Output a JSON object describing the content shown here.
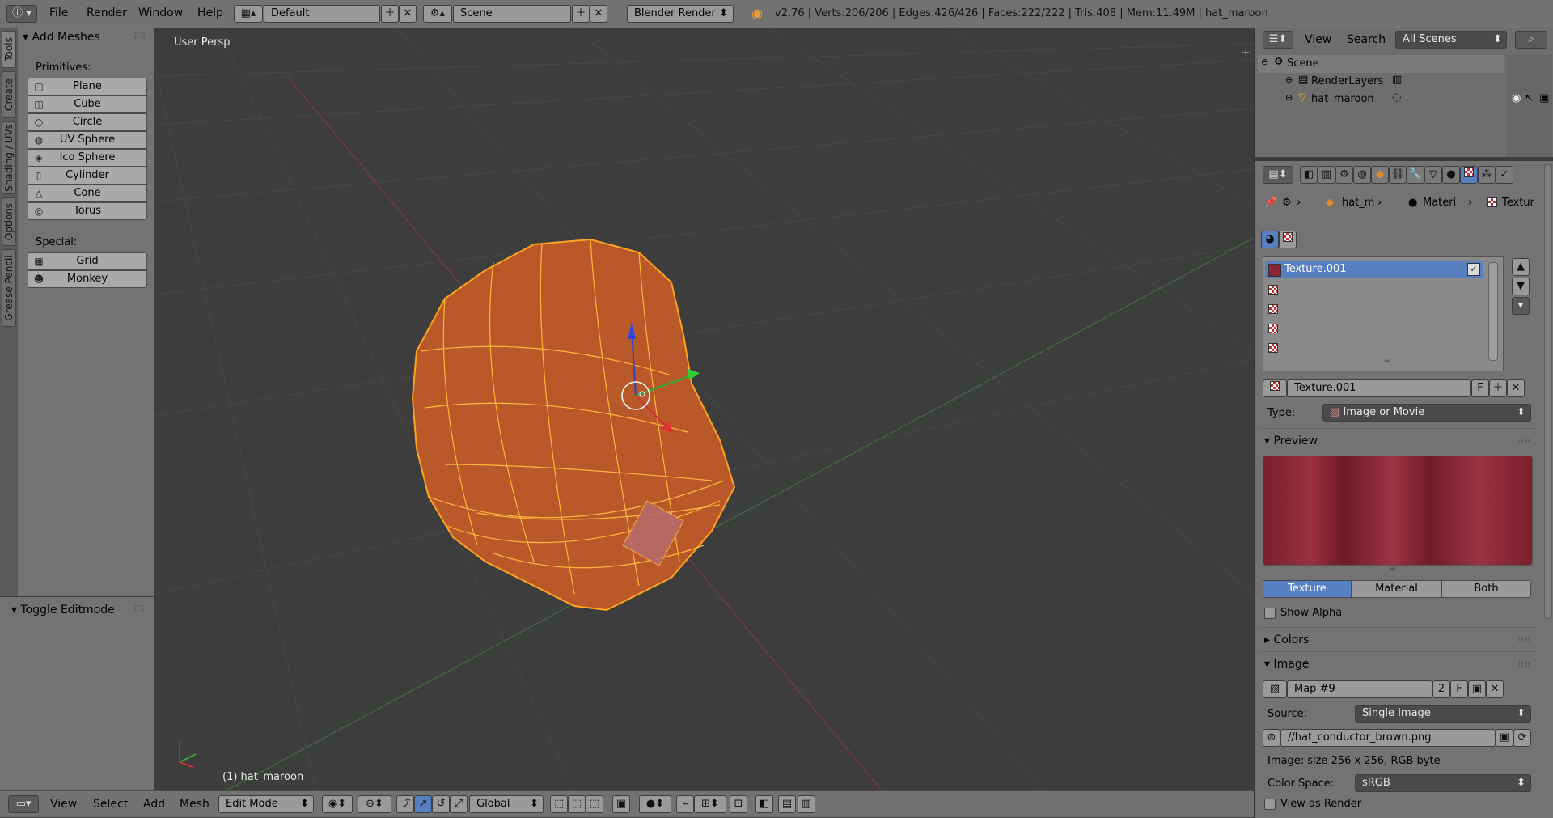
{
  "topbar": {
    "info_icon": "info-icon",
    "menus": [
      "File",
      "Render",
      "Window",
      "Help"
    ],
    "layout": "Default",
    "scene": "Scene",
    "engine": "Blender Render",
    "stats": "v2.76 | Verts:206/206 | Edges:426/426 | Faces:222/222 | Tris:408 | Mem:11.49M | hat_maroon"
  },
  "left_tabs": [
    "Tools",
    "Create",
    "Shading / UVs",
    "Options",
    "Grease Pencil"
  ],
  "toolshelf": {
    "panel_title": "Add Meshes",
    "primitives_label": "Primitives:",
    "primitives": [
      "Plane",
      "Cube",
      "Circle",
      "UV Sphere",
      "Ico Sphere",
      "Cylinder",
      "Cone",
      "Torus"
    ],
    "special_label": "Special:",
    "special": [
      "Grid",
      "Monkey"
    ]
  },
  "operator_panel": {
    "title": "Toggle Editmode"
  },
  "viewport": {
    "view_label": "User Persp",
    "object_label": "(1) hat_maroon"
  },
  "bottombar": {
    "menus": [
      "View",
      "Select",
      "Add",
      "Mesh"
    ],
    "mode": "Edit Mode",
    "orientation": "Global"
  },
  "outliner": {
    "menus": [
      "View",
      "Search"
    ],
    "filter": "All Scenes",
    "tree": [
      "Scene",
      "RenderLayers",
      "hat_maroon"
    ]
  },
  "properties": {
    "breadcrumb": [
      "hat_m",
      "Materi",
      "Textur"
    ],
    "texture_slots": [
      "Texture.001",
      "",
      "",
      "",
      ""
    ],
    "texture_name": "Texture.001",
    "texture_name_flag": "F",
    "type_label": "Type:",
    "type_value": "Image or Movie",
    "preview_title": "Preview",
    "preview_tabs": [
      "Texture",
      "Material",
      "Both"
    ],
    "show_alpha": "Show Alpha",
    "colors_title": "Colors",
    "image_title": "Image",
    "image_name": "Map #9",
    "image_users": "2",
    "image_flag": "F",
    "source_label": "Source:",
    "source_value": "Single Image",
    "filepath": "//hat_conductor_brown.png",
    "image_info": "Image: size 256 x 256, RGB byte",
    "color_space_label": "Color Space:",
    "color_space_value": "sRGB",
    "view_as_render": "View as Render"
  },
  "colors": {
    "mesh_fill": "#b9592a",
    "mesh_wire": "#ffa31f",
    "active_tab": "#5680c2",
    "texture_preview": "#8e2433"
  }
}
